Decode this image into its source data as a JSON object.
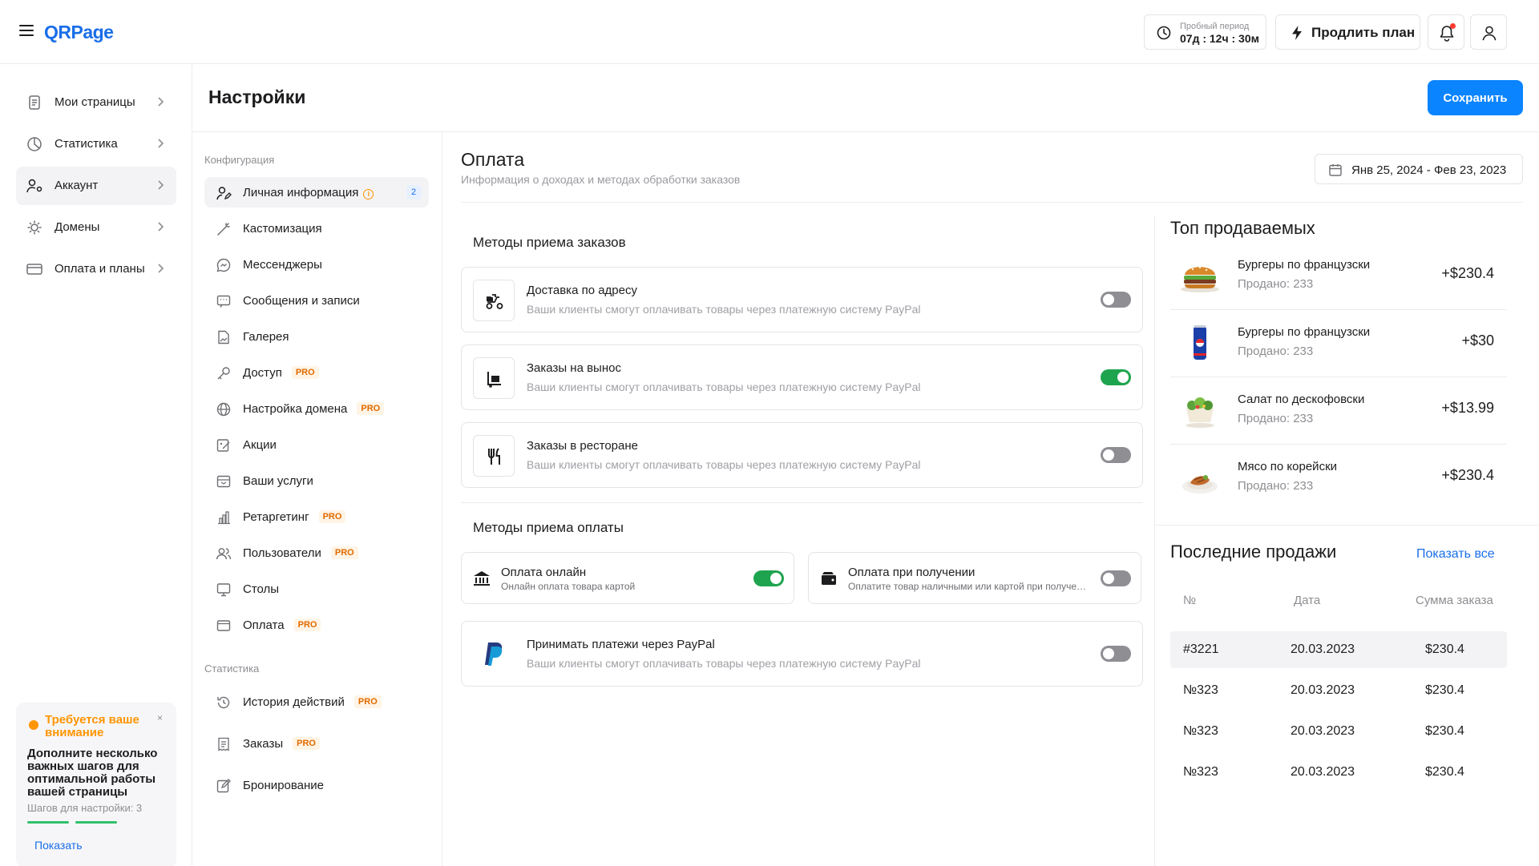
{
  "app": {
    "logo": "QRPage",
    "trial_label": "Пробный период",
    "trial_time": "07д : 12ч : 30м",
    "extend_label": "Продлить план"
  },
  "nav": {
    "items": [
      {
        "label": "Мои страницы",
        "icon": "pages-icon"
      },
      {
        "label": "Статистика",
        "icon": "chart-pie-icon"
      },
      {
        "label": "Аккаунт",
        "icon": "user-gear-icon",
        "active": true
      },
      {
        "label": "Домены",
        "icon": "domain-gear-icon"
      },
      {
        "label": "Оплата и планы",
        "icon": "card-icon"
      }
    ]
  },
  "attention": {
    "title": "Требуется ваше внимание",
    "body": "Дополните несколько важных шагов для оптимальной работы вашей страницы",
    "steps": "Шагов для настройки: 3",
    "show": "Показать",
    "close": "×",
    "accent": "#ff9500"
  },
  "page": {
    "title": "Настройки",
    "save": "Сохранить"
  },
  "settings_menu": {
    "config_label": "Конфигурация",
    "stats_label": "Статистика",
    "pro_label": "PRO",
    "info_mark": "i",
    "items": [
      {
        "label": "Личная информация",
        "badge": "2"
      },
      {
        "label": "Кастомизация"
      },
      {
        "label": "Мессенджеры"
      },
      {
        "label": "Сообщения и записи"
      },
      {
        "label": "Галерея"
      },
      {
        "label": "Доступ"
      },
      {
        "label": "Настройка домена"
      },
      {
        "label": "Акции"
      },
      {
        "label": "Ваши услуги"
      },
      {
        "label": "Ретаргетинг"
      },
      {
        "label": "Пользователи"
      },
      {
        "label": "Столы"
      },
      {
        "label": "Оплата"
      }
    ],
    "stats_items": [
      {
        "label": "История действий"
      },
      {
        "label": "Заказы"
      },
      {
        "label": "Бронирование"
      }
    ]
  },
  "payment": {
    "title": "Оплата",
    "subtitle": "Информация о доходах и методах обработки заказов",
    "date_range": "Янв 25, 2024 - Фев 23, 2023",
    "order_methods_title": "Методы приема заказов",
    "order_methods": [
      {
        "title": "Доставка по адресу",
        "desc": "Ваши клиенты смогут оплачивать товары через платежную систему PayPal",
        "enabled": false
      },
      {
        "title": "Заказы на вынос",
        "desc": "Ваши клиенты смогут оплачивать товары через платежную систему PayPal",
        "enabled": true
      },
      {
        "title": "Заказы в ресторане",
        "desc": "Ваши клиенты смогут оплачивать товары через платежную систему PayPal",
        "enabled": false
      }
    ],
    "payment_methods_title": "Методы приема оплаты",
    "payment_methods": [
      {
        "title": "Оплата онлайн",
        "desc": "Онлайн оплата товара картой",
        "enabled": true
      },
      {
        "title": "Оплата при получении",
        "desc": "Оплатите товар наличными или картой при получении",
        "enabled": false
      }
    ],
    "paypal": {
      "title": "Принимать платежи через PayPal",
      "desc": "Ваши клиенты смогут оплачивать товары через платежную систему PayPal",
      "enabled": false
    }
  },
  "top_sellers": {
    "title": "Топ продаваемых",
    "items": [
      {
        "name": "Бургеры по французски",
        "sold": "Продано: 233",
        "value": "+$230.4",
        "icon": "burger-icon"
      },
      {
        "name": "Бургеры по французски",
        "sold": "Продано: 233",
        "value": "+$30",
        "icon": "soda-can-icon"
      },
      {
        "name": "Салат по дескофовски",
        "sold": "Продано: 233",
        "value": "+$13.99",
        "icon": "salad-icon"
      },
      {
        "name": "Мясо по корейски",
        "sold": "Продано: 233",
        "value": "+$230.4",
        "icon": "meat-dish-icon"
      }
    ]
  },
  "recent_sales": {
    "title": "Последние продажи",
    "show_all": "Показать все",
    "columns": [
      "№",
      "Дата",
      "Сумма заказа"
    ],
    "rows": [
      [
        "#3221",
        "20.03.2023",
        "$230.4"
      ],
      [
        "№323",
        "20.03.2023",
        "$230.4"
      ],
      [
        "№323",
        "20.03.2023",
        "$230.4"
      ],
      [
        "№323",
        "20.03.2023",
        "$230.4"
      ]
    ]
  },
  "colors": {
    "accent": "#0a84ff",
    "link": "#1a6ee8",
    "toggle_on": "#1ea44e",
    "toggle_off": "#8e8e93",
    "pro_badge": "#e06a00"
  }
}
